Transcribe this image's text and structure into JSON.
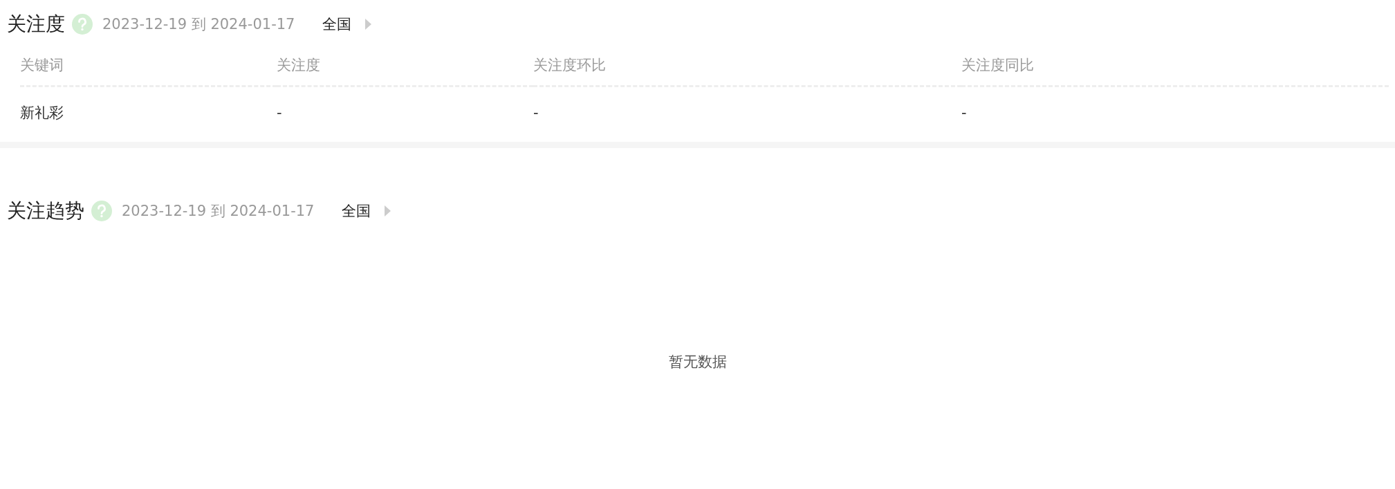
{
  "sections": [
    {
      "kind": "table",
      "title": "关注度",
      "date_range": "2023-12-19 到 2024-01-17",
      "region": "全国",
      "columns": [
        "关键词",
        "关注度",
        "关注度环比",
        "关注度同比"
      ],
      "rows": [
        [
          "新礼彩",
          "-",
          "-",
          "-"
        ]
      ]
    },
    {
      "kind": "empty",
      "title": "关注趋势",
      "date_range": "2023-12-19 到 2024-01-17",
      "region": "全国",
      "empty_text": "暂无数据"
    }
  ]
}
